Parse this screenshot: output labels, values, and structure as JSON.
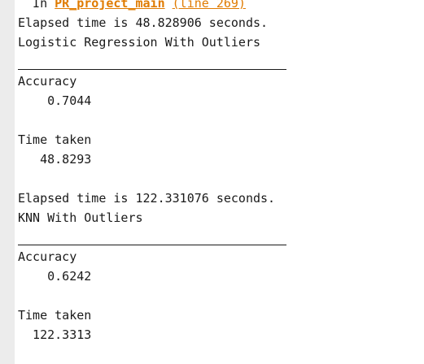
{
  "colors": {
    "link": "#e07b00",
    "text": "#1a1a1a",
    "gutter": "#ececec"
  },
  "header": {
    "prefix": "  In ",
    "function_link": "PR_project_main",
    "spacer": " ",
    "line_link": "(line 269)"
  },
  "block1": {
    "elapsed": "Elapsed time is 48.828906 seconds.",
    "title": "Logistic Regression With Outliers",
    "accuracy_label": "Accuracy",
    "accuracy_value": "    0.7044",
    "time_label": "Time taken",
    "time_value": "   48.8293"
  },
  "block2": {
    "elapsed": "Elapsed time is 122.331076 seconds.",
    "title": "KNN With Outliers",
    "accuracy_label": "Accuracy",
    "accuracy_value": "    0.6242",
    "time_label": "Time taken",
    "time_value": "  122.3313"
  }
}
